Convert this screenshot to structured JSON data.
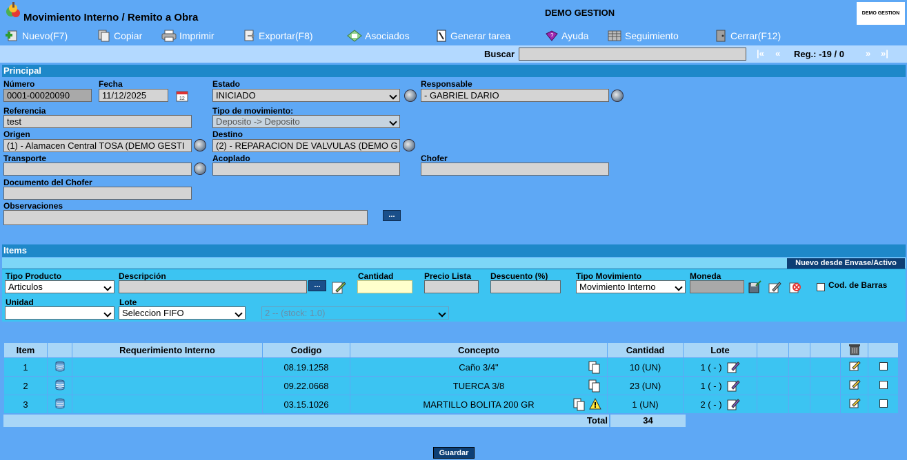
{
  "header": {
    "title": "Movimiento Interno / Remito a Obra",
    "company": "DEMO GESTION",
    "company_logo_text": "DEMO GESTION"
  },
  "toolbar": {
    "nuevo": "Nuevo(F7)",
    "copiar": "Copiar",
    "imprimir": "Imprimir",
    "exportar": "Exportar(F8)",
    "asociados": "Asociados",
    "generar_tarea": "Generar tarea",
    "ayuda": "Ayuda",
    "seguimiento": "Seguimiento",
    "cerrar": "Cerrar(F12)"
  },
  "search": {
    "label": "Buscar",
    "value": "",
    "nav_first": "|«",
    "nav_prev": "«",
    "reg_label": "Reg.: -19 / 0",
    "nav_next": "»",
    "nav_last": "»|"
  },
  "principal": {
    "section_title": "Principal",
    "numero_label": "Número",
    "numero_value": "0001-00020090",
    "fecha_label": "Fecha",
    "fecha_value": "11/12/2025",
    "estado_label": "Estado",
    "estado_value": "INICIADO",
    "responsable_label": "Responsable",
    "responsable_value": "- GABRIEL DARIO",
    "referencia_label": "Referencia",
    "referencia_value": "test",
    "tipo_mov_label": "Tipo de movimiento:",
    "tipo_mov_value": "Deposito -> Deposito",
    "origen_label": "Origen",
    "origen_value": "(1) - Alamacen Central TOSA (DEMO GESTI",
    "destino_label": "Destino",
    "destino_value": "(2) - REPARACION DE VALVULAS  (DEMO G",
    "transporte_label": "Transporte",
    "transporte_value": "",
    "acoplado_label": "Acoplado",
    "acoplado_value": "",
    "chofer_label": "Chofer",
    "chofer_value": "",
    "doc_chofer_label": "Documento del Chofer",
    "doc_chofer_value": "",
    "observaciones_label": "Observaciones",
    "observaciones_value": "",
    "dots": "..."
  },
  "items_form": {
    "section_title": "Items",
    "nuevo_envase": "Nuevo desde Envase/Activo",
    "tipo_producto_label": "Tipo Producto",
    "tipo_producto_value": "Articulos",
    "descripcion_label": "Descripción",
    "descripcion_value": "",
    "dots": "...",
    "cantidad_label": "Cantidad",
    "cantidad_value": "",
    "precio_lista_label": "Precio Lista",
    "precio_lista_value": "",
    "descuento_label": "Descuento (%)",
    "descuento_value": "",
    "tipo_movimiento_label": "Tipo Movimiento",
    "tipo_movimiento_value": "Movimiento Interno",
    "moneda_label": "Moneda",
    "moneda_value": "",
    "cod_barras_label": "Cod. de Barras",
    "unidad_label": "Unidad",
    "unidad_value": "",
    "lote_label": "Lote",
    "lote_value": "Seleccion FIFO",
    "stock_value": "2 -- (stock: 1.0)"
  },
  "table": {
    "headers": {
      "item": "Item",
      "requerimiento": "Requerimiento Interno",
      "codigo": "Codigo",
      "concepto": "Concepto",
      "cantidad": "Cantidad",
      "lote": "Lote"
    },
    "rows": [
      {
        "item": "1",
        "requerimiento": "",
        "codigo": "08.19.1258",
        "concepto": "Caño 3/4\"",
        "cantidad": "10 (UN)",
        "lote": "1 ( - )"
      },
      {
        "item": "2",
        "requerimiento": "",
        "codigo": "09.22.0668",
        "concepto": "TUERCA 3/8",
        "cantidad": "23 (UN)",
        "lote": "1 ( - )"
      },
      {
        "item": "3",
        "requerimiento": "",
        "codigo": "03.15.1026",
        "concepto": "MARTILLO  BOLITA 200 GR",
        "cantidad": "1 (UN)",
        "lote": "2 ( - )"
      }
    ],
    "total_label": "Total",
    "total_value": "34"
  },
  "footer": {
    "guardar": "Guardar"
  }
}
